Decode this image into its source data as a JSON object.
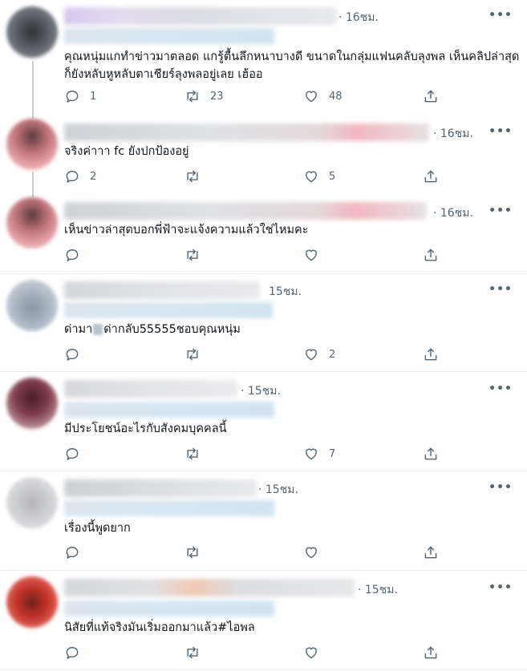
{
  "tweets": [
    {
      "time": "· 16ชม.",
      "more": "•••",
      "text": "คุณหนุ่มแกทำข่าวมาตลอด แกรู้ตื้นลึกหนาบางดี ขนาดในกลุ่มแฟนคลับลุงพล เห็นคลิปล่าสุดก็ยังหลับหูหลับตาเชียร์ลุงพลอยู่เลย เฮ้ออ",
      "reply_count": "1",
      "retweet_count": "23",
      "like_count": "48",
      "avatar_color": "#5a5f63"
    },
    {
      "time": "· 16ชม.",
      "more": "•••",
      "text": "จริงค่าาา fc ยังปกป้องอยู่",
      "reply_count": "2",
      "retweet_count": "",
      "like_count": "5",
      "avatar_color": "#d98a8f"
    },
    {
      "time": "· 16ชม.",
      "more": "•••",
      "text": "เห็นข่าวล่าสุดบอกพี่ฟ้าจะแจ้งความแล้วใช่ไหมคะ",
      "reply_count": "",
      "retweet_count": "",
      "like_count": "",
      "avatar_color": "#d98a8f"
    },
    {
      "time": "15ชม.",
      "more": "•••",
      "text_pre": "ด่ามา",
      "text_post": "ด่ากลับ55555ชอบคุณหนุ่ม",
      "reply_count": "",
      "retweet_count": "",
      "like_count": "2",
      "avatar_color": "#9aa9b8"
    },
    {
      "time": "· 15ชม.",
      "more": "•••",
      "text": "มีประโยชน์อะไรกับสังคมบุคคลนี้",
      "reply_count": "",
      "retweet_count": "",
      "like_count": "7",
      "avatar_color": "#7e3a4a"
    },
    {
      "time": "· 15ชม.",
      "more": "•••",
      "text": "เรื่องนี้พูดยาก",
      "reply_count": "",
      "retweet_count": "",
      "like_count": "",
      "avatar_color": "#c9c9cc"
    },
    {
      "time": "· 15ชม.",
      "more": "•••",
      "text": "นิสัยที่แท้จริงมันเริ่มออกมาแล้ว#ไอพล",
      "reply_count": "",
      "retweet_count": "",
      "like_count": "",
      "avatar_color": "#c0302a"
    }
  ],
  "icons": {
    "reply": "reply-icon",
    "retweet": "retweet-icon",
    "like": "heart-icon",
    "share": "share-icon",
    "more": "more-icon"
  }
}
